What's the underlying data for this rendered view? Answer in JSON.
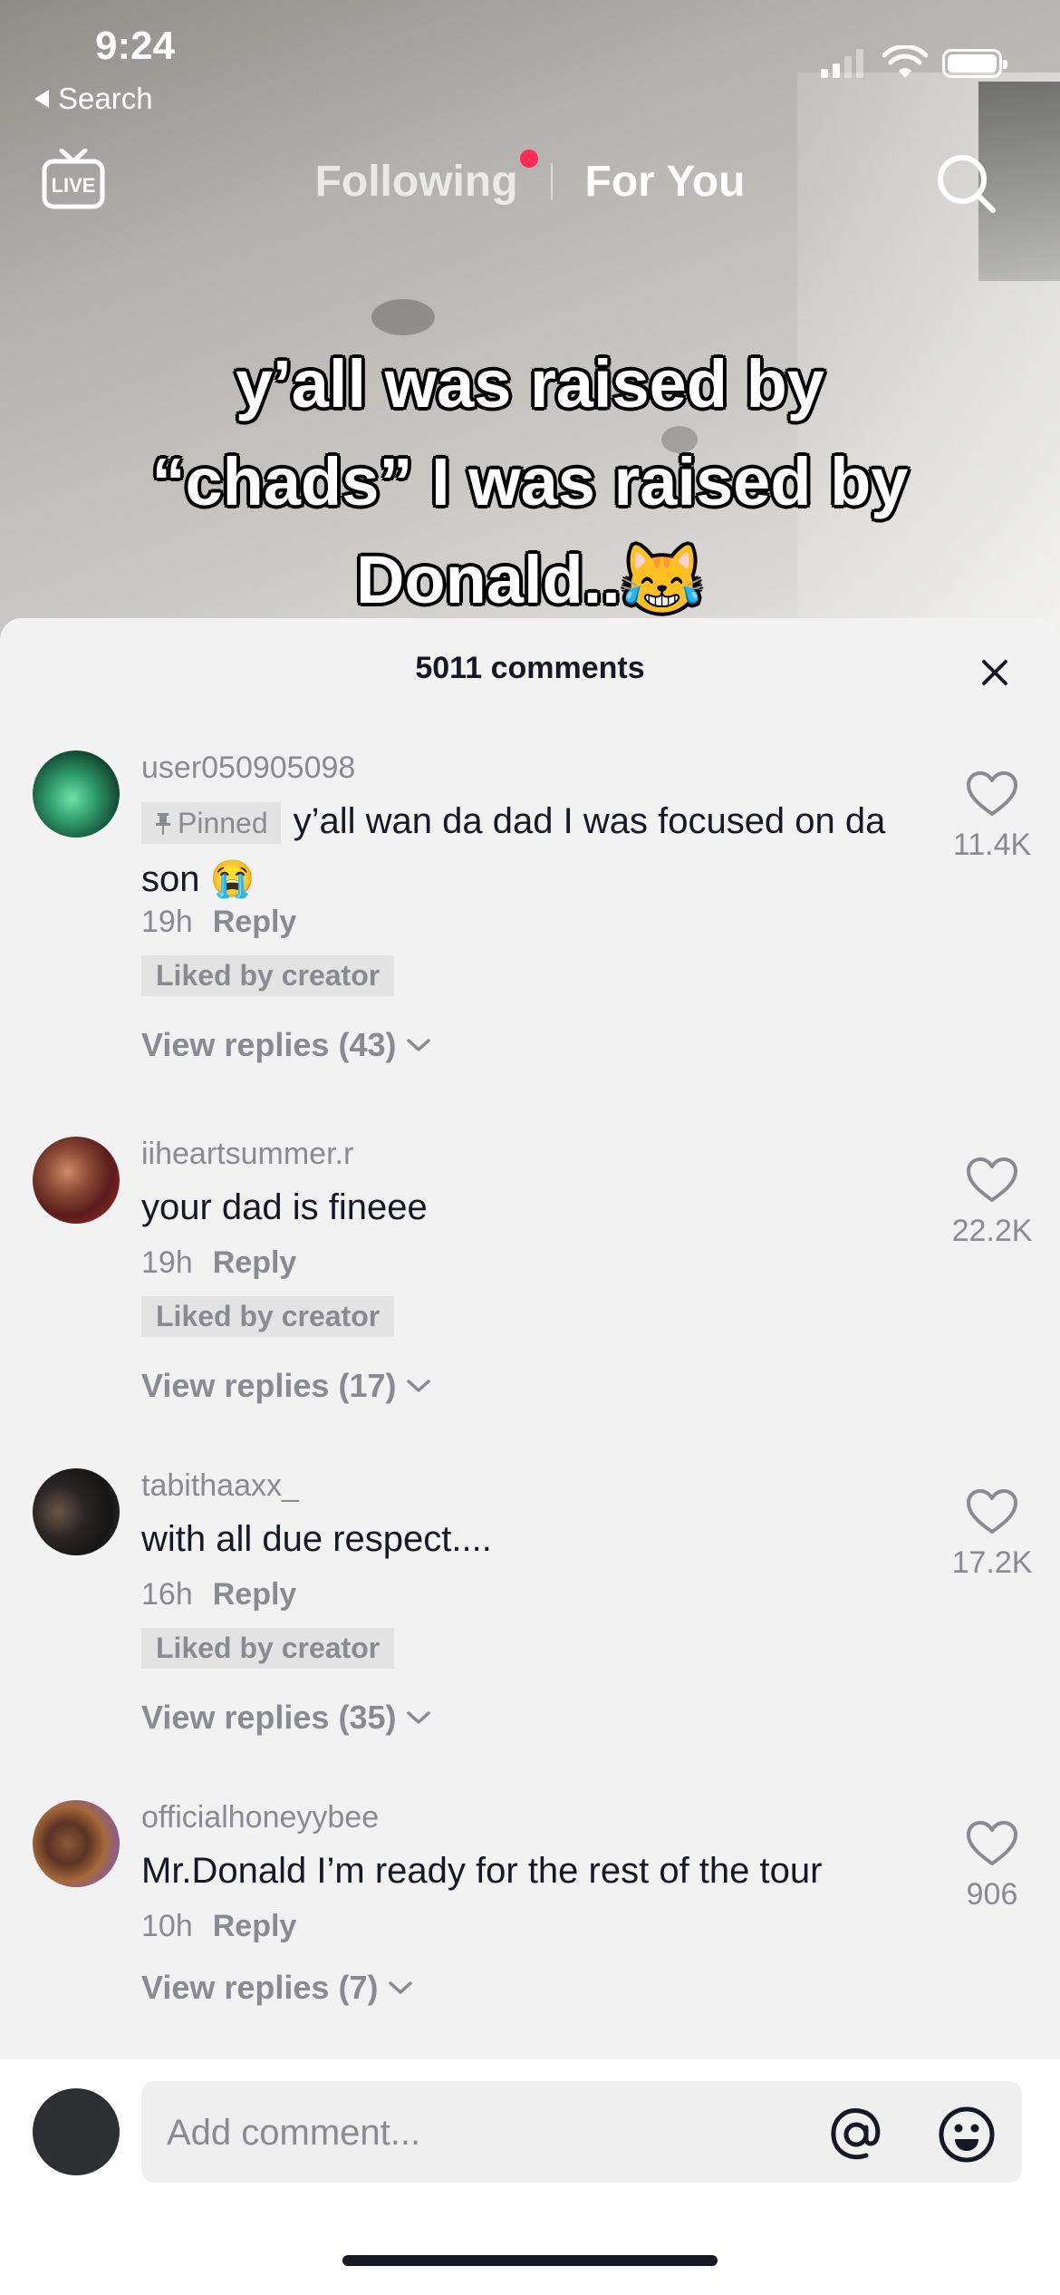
{
  "status_bar": {
    "time": "9:24",
    "back_label": "Search"
  },
  "top_nav": {
    "live_label": "LIVE",
    "tab_following": "Following",
    "tab_for_you": "For You"
  },
  "video": {
    "caption_lines": [
      "y’all was raised by",
      "“chads” I was raised by",
      "Donald..😹"
    ]
  },
  "comments_sheet": {
    "title": "5011 comments",
    "comments": [
      {
        "user": "user050905098",
        "pinned_label": "Pinned",
        "text": "y’all wan da dad I was focused on da son 😭",
        "time": "19h",
        "reply": "Reply",
        "liked_badge": "Liked by creator",
        "view_replies": "View replies (43)",
        "likes": "11.4K"
      },
      {
        "user": "iiheartsummer.r",
        "text": "your dad is fineee",
        "time": "19h",
        "reply": "Reply",
        "liked_badge": "Liked by creator",
        "view_replies": "View replies (17)",
        "likes": "22.2K"
      },
      {
        "user": "tabithaaxx_",
        "text": "with all due respect....",
        "time": "16h",
        "reply": "Reply",
        "liked_badge": "Liked by creator",
        "view_replies": "View replies (35)",
        "likes": "17.2K"
      },
      {
        "user": "officialhoneyybee",
        "text": "Mr.Donald I’m ready for the rest of the tour",
        "time": "10h",
        "reply": "Reply",
        "view_replies": "View replies (7)",
        "likes": "906"
      }
    ]
  },
  "comment_input": {
    "placeholder": "Add comment..."
  },
  "colors": {
    "accent_dot": "#fe2c55",
    "text_primary": "#161823",
    "text_secondary": "#8a8b91"
  },
  "icons": [
    "live-icon",
    "search-icon",
    "close-icon",
    "heart-icon",
    "pin-icon",
    "chevron-down-icon",
    "at-icon",
    "emoji-icon"
  ]
}
